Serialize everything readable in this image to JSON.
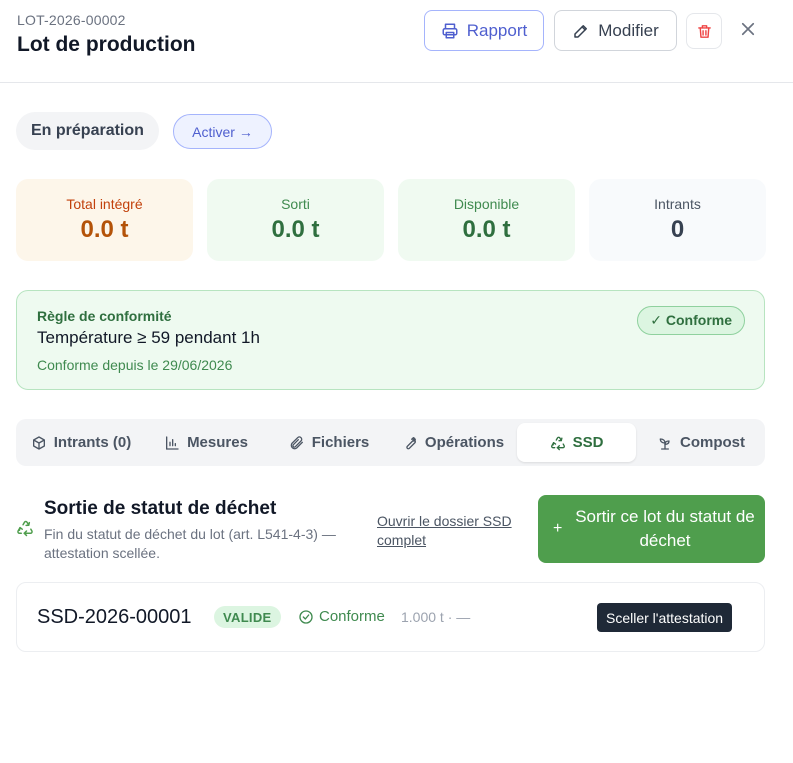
{
  "header": {
    "lot_code": "LOT-2026-00002",
    "title": "Lot de production",
    "rapport_label": "Rapport",
    "modifier_label": "Modifier"
  },
  "status": {
    "current": "En préparation",
    "action_label": "Activer →"
  },
  "stats": [
    {
      "label": "Total intégré",
      "value": "0.0 t"
    },
    {
      "label": "Sorti",
      "value": "0.0 t"
    },
    {
      "label": "Disponible",
      "value": "0.0 t"
    },
    {
      "label": "Intrants",
      "value": "0"
    }
  ],
  "compliance": {
    "title": "Règle de conformité",
    "rule": "Température ≥ 59 pendant 1h",
    "since": "Conforme depuis le 29/06/2026",
    "badge": "✓ Conforme"
  },
  "tabs": [
    {
      "label": "Intrants (0)",
      "icon": "cube-icon"
    },
    {
      "label": "Mesures",
      "icon": "bar-chart-icon"
    },
    {
      "label": "Fichiers",
      "icon": "paperclip-icon"
    },
    {
      "label": "Opérations",
      "icon": "wrench-icon"
    },
    {
      "label": "SSD",
      "icon": "recycle-icon",
      "active": true
    },
    {
      "label": "Compost",
      "icon": "sprout-icon"
    }
  ],
  "ssd": {
    "title": "Sortie de statut de déchet",
    "description": "Fin du statut de déchet du lot (art. L541-4-3) — attestation scellée.",
    "link": "Ouvrir le dossier SSD complet",
    "button_plus": "+",
    "button_label": "Sortir ce lot du statut de déchet"
  },
  "record": {
    "id": "SSD-2026-00001",
    "badge": "VALIDE",
    "status": "Conforme",
    "quantity": "1.000 t · —",
    "action": "Sceller l'attestation"
  },
  "colors": {
    "accent_green": "#4f9e4d",
    "accent_indigo": "#4f5fcf",
    "warning_orange": "#b45309",
    "danger_red": "#ef4444"
  }
}
